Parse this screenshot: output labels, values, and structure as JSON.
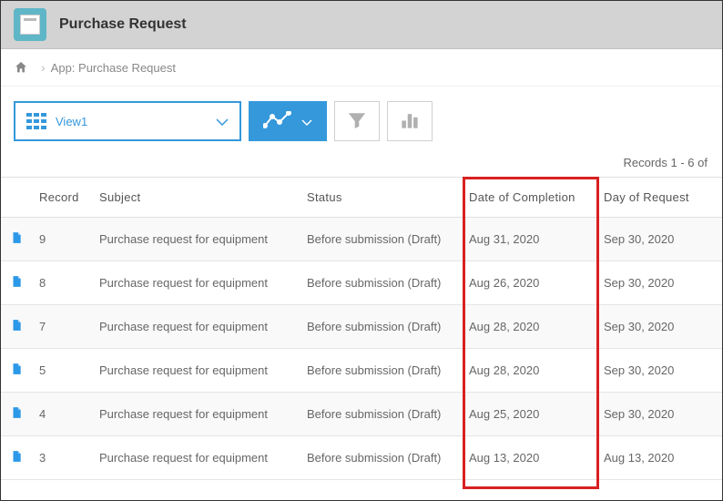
{
  "header": {
    "title": "Purchase Request"
  },
  "breadcrumb": {
    "text": "App: Purchase Request"
  },
  "toolbar": {
    "viewLabel": "View1"
  },
  "recordsCount": "Records 1 - 6 of",
  "columns": {
    "record": "Record",
    "subject": "Subject",
    "status": "Status",
    "dateCompletion": "Date of Completion",
    "dayRequest": "Day of Request"
  },
  "rows": [
    {
      "record": "9",
      "subject": "Purchase request for equipment",
      "status": "Before submission (Draft)",
      "dateCompletion": "Aug 31, 2020",
      "dayRequest": "Sep 30, 2020"
    },
    {
      "record": "8",
      "subject": "Purchase request for equipment",
      "status": "Before submission (Draft)",
      "dateCompletion": "Aug 26, 2020",
      "dayRequest": "Sep 30, 2020"
    },
    {
      "record": "7",
      "subject": "Purchase request for equipment",
      "status": "Before submission (Draft)",
      "dateCompletion": "Aug 28, 2020",
      "dayRequest": "Sep 30, 2020"
    },
    {
      "record": "5",
      "subject": "Purchase request for equipment",
      "status": "Before submission (Draft)",
      "dateCompletion": "Aug 28, 2020",
      "dayRequest": "Sep 30, 2020"
    },
    {
      "record": "4",
      "subject": "Purchase request for equipment",
      "status": "Before submission (Draft)",
      "dateCompletion": "Aug 25, 2020",
      "dayRequest": "Sep 30, 2020"
    },
    {
      "record": "3",
      "subject": "Purchase request for equipment",
      "status": "Before submission (Draft)",
      "dateCompletion": "Aug 13, 2020",
      "dayRequest": "Aug 13, 2020"
    }
  ]
}
